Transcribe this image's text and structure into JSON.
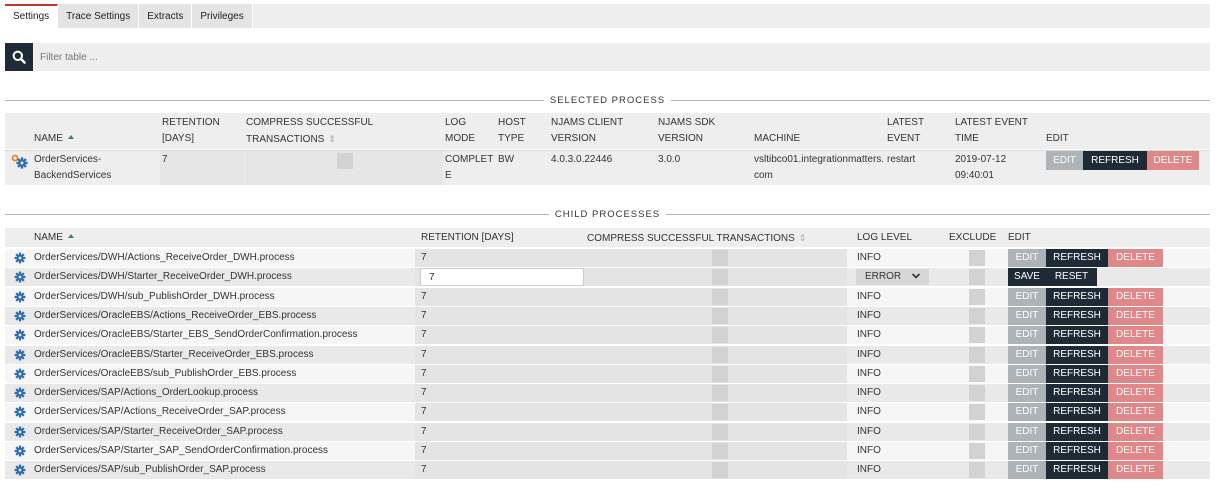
{
  "tabs": [
    "Settings",
    "Trace Settings",
    "Extracts",
    "Privileges"
  ],
  "filter": {
    "placeholder": "Filter table ..."
  },
  "selected_process": {
    "title": "SELECTED PROCESS",
    "headers": {
      "name": "NAME",
      "retention_1": "RETENTION",
      "retention_2": "[DAYS]",
      "compress_1": "COMPRESS SUCCESSFUL",
      "compress_2": "TRANSACTIONS",
      "logmode_1": "LOG",
      "logmode_2": "MODE",
      "hosttype_1": "HOST",
      "hosttype_2": "TYPE",
      "client_1": "NJAMS CLIENT",
      "client_2": "VERSION",
      "sdk_1": "NJAMS SDK",
      "sdk_2": "VERSION",
      "machine": "MACHINE",
      "latestevent_1": "LATEST",
      "latestevent_2": "EVENT",
      "latesttime_1": "LATEST EVENT",
      "latesttime_2": "TIME",
      "edit": "EDIT"
    },
    "row": {
      "name_1": "OrderServices-",
      "name_2": "BackendServices",
      "retention": "7",
      "logmode_1": "COMPLET",
      "logmode_2": "E",
      "hosttype": "BW",
      "client_version": "4.0.3.0.22446",
      "sdk_version": "3.0.0",
      "machine_1": "vsltibco01.integrationmatters.",
      "machine_2": "com",
      "latest_event": "restart",
      "latest_time_1": "2019-07-12",
      "latest_time_2": "09:40:01"
    },
    "buttons": {
      "edit": "EDIT",
      "refresh": "REFRESH",
      "delete": "DELETE"
    }
  },
  "child_processes": {
    "title": "CHILD PROCESSES",
    "headers": {
      "name": "NAME",
      "retention": "RETENTION [DAYS]",
      "compress": "COMPRESS SUCCESSFUL TRANSACTIONS",
      "loglevel": "LOG LEVEL",
      "exclude": "EXCLUDE",
      "edit": "EDIT"
    },
    "buttons": {
      "edit": "EDIT",
      "refresh": "REFRESH",
      "delete": "DELETE",
      "save": "SAVE",
      "reset": "RESET"
    },
    "editing_row": {
      "name": "OrderServices/DWH/Starter_ReceiveOrder_DWH.process",
      "retention_value": "7",
      "loglevel_value": "ERROR"
    },
    "rows": [
      {
        "name": "OrderServices/DWH/Actions_ReceiveOrder_DWH.process",
        "retention": "7",
        "loglevel": "INFO"
      },
      {
        "name": "OrderServices/DWH/sub_PublishOrder_DWH.process",
        "retention": "7",
        "loglevel": "INFO"
      },
      {
        "name": "OrderServices/OracleEBS/Actions_ReceiveOrder_EBS.process",
        "retention": "7",
        "loglevel": "INFO"
      },
      {
        "name": "OrderServices/OracleEBS/Starter_EBS_SendOrderConfirmation.process",
        "retention": "7",
        "loglevel": "INFO"
      },
      {
        "name": "OrderServices/OracleEBS/Starter_ReceiveOrder_EBS.process",
        "retention": "7",
        "loglevel": "INFO"
      },
      {
        "name": "OrderServices/OracleEBS/sub_PublishOrder_EBS.process",
        "retention": "7",
        "loglevel": "INFO"
      },
      {
        "name": "OrderServices/SAP/Actions_OrderLookup.process",
        "retention": "7",
        "loglevel": "INFO"
      },
      {
        "name": "OrderServices/SAP/Actions_ReceiveOrder_SAP.process",
        "retention": "7",
        "loglevel": "INFO"
      },
      {
        "name": "OrderServices/SAP/Starter_ReceiveOrder_SAP.process",
        "retention": "7",
        "loglevel": "INFO"
      },
      {
        "name": "OrderServices/SAP/Starter_SAP_SendOrderConfirmation.process",
        "retention": "7",
        "loglevel": "INFO"
      },
      {
        "name": "OrderServices/SAP/sub_PublishOrder_SAP.process",
        "retention": "7",
        "loglevel": "INFO"
      }
    ]
  },
  "colors": {
    "dark_button": "#1e2b36",
    "edit_button": "#aeb3b8",
    "delete_button": "#e08789",
    "active_tab_accent": "#c0392b",
    "gear_icon": "#2b6cb0",
    "gear_icon_secondary": "#e07b2a"
  }
}
